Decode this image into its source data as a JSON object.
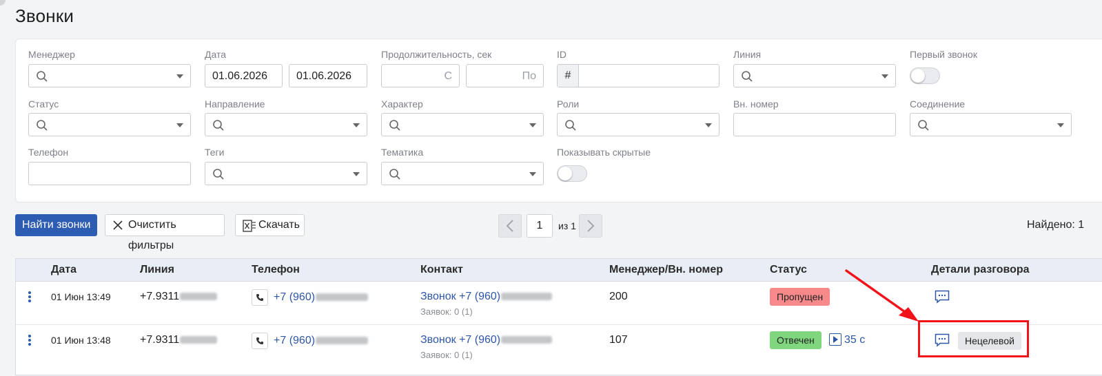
{
  "page": {
    "title": "Звонки"
  },
  "filters": {
    "manager": {
      "label": "Менеджер"
    },
    "date": {
      "label": "Дата",
      "from": "01.06.2026",
      "to": "01.06.2026"
    },
    "duration": {
      "label": "Продолжительность, сек",
      "from_placeholder": "С",
      "to_placeholder": "По"
    },
    "id": {
      "label": "ID",
      "prefix": "#"
    },
    "line": {
      "label": "Линия"
    },
    "first_call": {
      "label": "Первый звонок",
      "enabled": false
    },
    "status": {
      "label": "Статус"
    },
    "direction": {
      "label": "Направление"
    },
    "character": {
      "label": "Характер"
    },
    "roles": {
      "label": "Роли"
    },
    "ext_number": {
      "label": "Вн. номер"
    },
    "connection": {
      "label": "Соединение"
    },
    "phone": {
      "label": "Телефон"
    },
    "tags": {
      "label": "Теги"
    },
    "topic": {
      "label": "Тематика"
    },
    "show_hidden": {
      "label": "Показывать скрытые",
      "enabled": false
    }
  },
  "toolbar": {
    "find_label": "Найти звонки",
    "clear_label": "Очистить фильтры",
    "download_label": "Скачать"
  },
  "pagination": {
    "current": "1",
    "of_label": "из 1"
  },
  "found": {
    "label": "Найдено: 1"
  },
  "table": {
    "headers": {
      "date": "Дата",
      "line": "Линия",
      "phone": "Телефон",
      "contact": "Контакт",
      "manager": "Менеджер/Вн. номер",
      "status": "Статус",
      "details": "Детали разговора"
    },
    "rows": [
      {
        "date": "01 Июн 13:49",
        "line": "+7.9311",
        "phone": "+7 (960)",
        "contact": "Звонок +7 (960)",
        "requests": "Заявок: 0 (1)",
        "manager": "200",
        "status": "Пропущен",
        "status_type": "missed",
        "duration": "",
        "tag": ""
      },
      {
        "date": "01 Июн 13:48",
        "line": "+7.9311",
        "phone": "+7 (960)",
        "contact": "Звонок +7 (960)",
        "requests": "Заявок: 0 (1)",
        "manager": "107",
        "status": "Отвечен",
        "status_type": "answered",
        "duration": "35 с",
        "tag": "Нецелевой"
      }
    ]
  },
  "icons": {
    "search": "search-icon",
    "caret": "chevron-down-icon",
    "close": "close-icon",
    "excel": "excel-icon",
    "phone": "phone-icon",
    "chat": "chat-icon",
    "play": "play-icon",
    "menu": "more-vertical-icon"
  },
  "colors": {
    "primary": "#2d5cb3",
    "link": "#2d56a8",
    "missed": "#f7898a",
    "answered": "#7fd67f",
    "annotation": "#f2131a"
  }
}
